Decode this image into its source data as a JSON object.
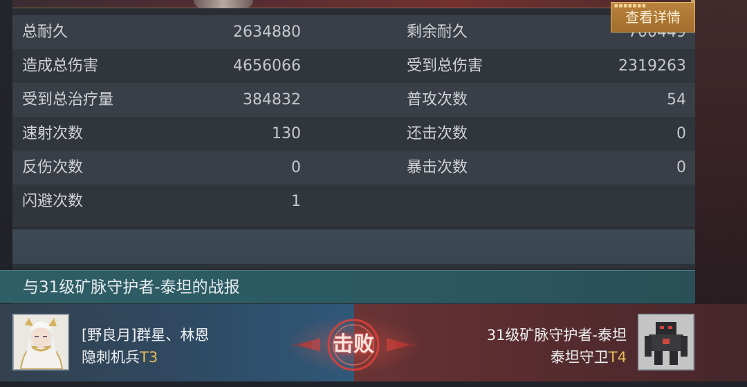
{
  "stats": {
    "left": [
      {
        "label": "总耐久",
        "value": "2634880"
      },
      {
        "label": "造成总伤害",
        "value": "4656066"
      },
      {
        "label": "受到总治疗量",
        "value": "384832"
      },
      {
        "label": "速射次数",
        "value": "130"
      },
      {
        "label": "反伤次数",
        "value": "0"
      },
      {
        "label": "闪避次数",
        "value": "1"
      }
    ],
    "right": [
      {
        "label": "剩余耐久",
        "value": "700449"
      },
      {
        "label": "受到总伤害",
        "value": "2319263"
      },
      {
        "label": "普攻次数",
        "value": "54"
      },
      {
        "label": "还击次数",
        "value": "0"
      },
      {
        "label": "暴击次数",
        "value": "0"
      }
    ]
  },
  "report": {
    "title": "与31级矿脉守护者-泰坦的战报",
    "detail_button": "查看详情"
  },
  "matchup": {
    "left": {
      "name": "[野良月]群星、林恩",
      "unit": "隐刺机兵",
      "tier": "T3"
    },
    "result": "击败",
    "right": {
      "name": "31级矿脉守护者-泰坦",
      "unit": "泰坦守卫",
      "tier": "T4"
    }
  },
  "colors": {
    "tier_gold": "#e7bd5a",
    "button_gold": "#b9833c",
    "header_teal": "#2e5e66",
    "left_side_blue": "#2f5878",
    "right_side_red": "#6a3334",
    "result_glow": "#e0413b"
  }
}
